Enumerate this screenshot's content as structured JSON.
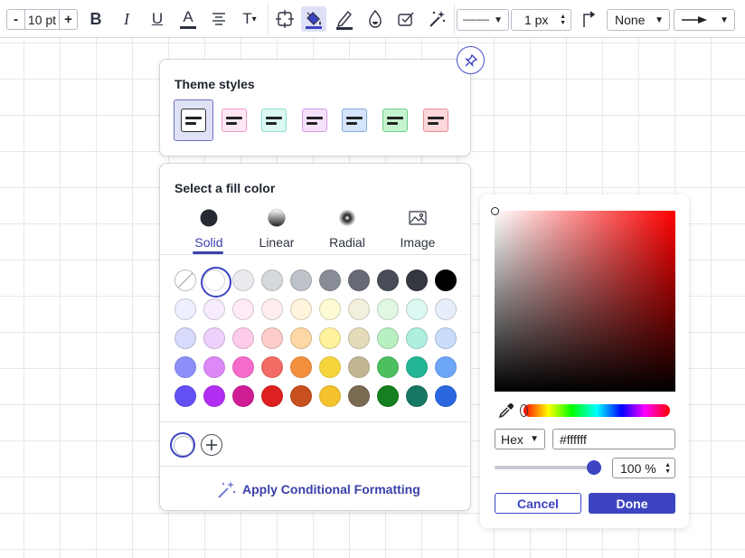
{
  "toolbar": {
    "font_size": {
      "minus": "-",
      "value": "10 pt",
      "plus": "+"
    },
    "bold_label": "B",
    "italic_label": "I",
    "underline_label": "U",
    "font_color_label": "A",
    "text_options_label": "T",
    "line_style": "———",
    "line_width": "1 px",
    "endpoint_start": "None"
  },
  "theme_panel": {
    "title": "Theme styles",
    "swatches": [
      {
        "fill": "#ffffff",
        "border": "#333333"
      },
      {
        "fill": "#ffe8f4",
        "border": "#f29ac9"
      },
      {
        "fill": "#dbf8f2",
        "border": "#8ee0cf"
      },
      {
        "fill": "#f5e1fb",
        "border": "#d59ae8"
      },
      {
        "fill": "#d4e5fb",
        "border": "#86a9dc"
      },
      {
        "fill": "#c5f3cf",
        "border": "#6fd08a"
      },
      {
        "fill": "#fcd7d9",
        "border": "#ec8d93"
      }
    ]
  },
  "fill_panel": {
    "title": "Select a fill color",
    "tabs": [
      {
        "label": "Solid"
      },
      {
        "label": "Linear"
      },
      {
        "label": "Radial"
      },
      {
        "label": "Image"
      }
    ],
    "palette": [
      [
        "none",
        "#ffffff",
        "#e9ebee",
        "#d5d8dd",
        "#bec2c9",
        "#878c96",
        "#656a74",
        "#474c56",
        "#333740",
        "#000000"
      ],
      [
        "#eef0ff",
        "#f7ecfd",
        "#ffeaf6",
        "#ffecee",
        "#fff3db",
        "#fdfbd3",
        "#f2f0dd",
        "#e0f7e2",
        "#dcf8f2",
        "#e6eefb"
      ],
      [
        "#d9dbfc",
        "#eed0fc",
        "#ffcbea",
        "#fccdca",
        "#fdd8a6",
        "#fff29c",
        "#e4dcb9",
        "#b9f0c2",
        "#aef0e0",
        "#c9dcfb"
      ],
      [
        "#8b8ff7",
        "#dc88f7",
        "#f56bcc",
        "#f26b64",
        "#f48f3e",
        "#f6d53c",
        "#c2b592",
        "#4cbf5f",
        "#22b596",
        "#6ea6f7"
      ],
      [
        "#6350f5",
        "#b12df2",
        "#cf1e95",
        "#dd2020",
        "#c84f1e",
        "#f5c22e",
        "#7a6a52",
        "#15801f",
        "#167863",
        "#2a67df"
      ]
    ],
    "apply_label": "Apply Conditional Formatting"
  },
  "color_picker": {
    "hue_color": "#ff0000",
    "format": "Hex",
    "hex_value": "#ffffff",
    "opacity": 100,
    "opacity_label": "100 %",
    "cancel_label": "Cancel",
    "done_label": "Done"
  },
  "colors": {
    "accent": "#3d44c2",
    "accent_text": "#3a3fa8"
  }
}
